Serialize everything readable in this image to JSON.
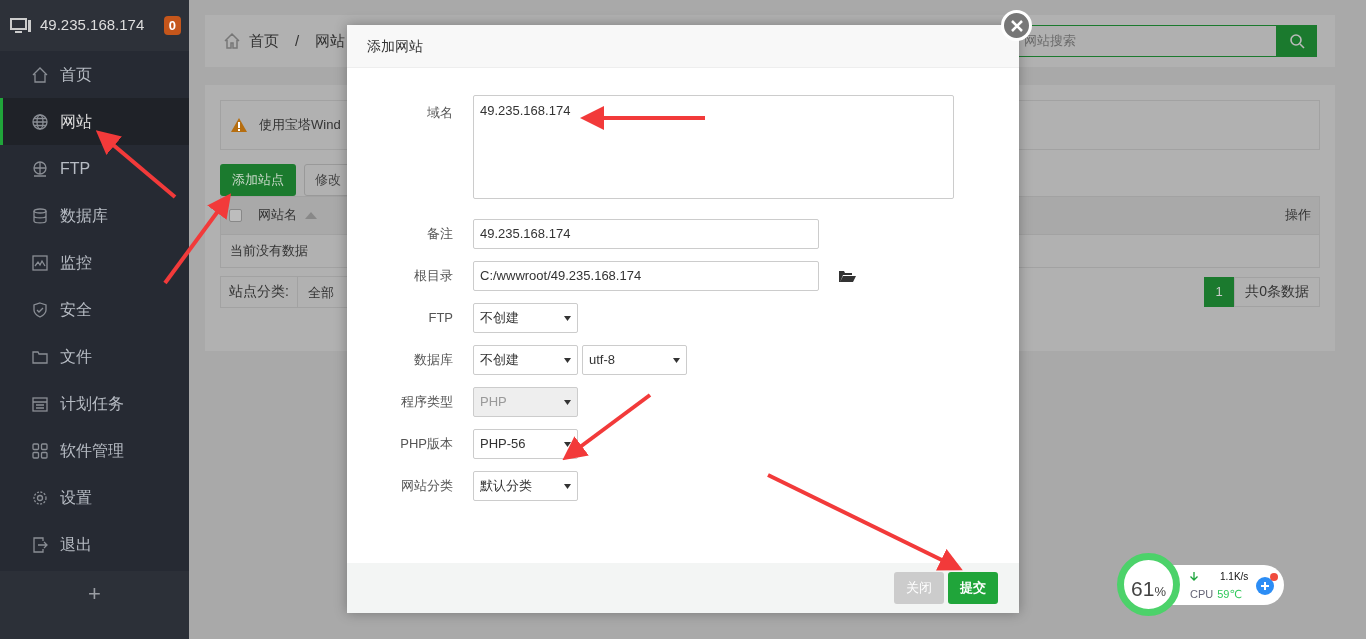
{
  "sidebar": {
    "host": "49.235.168.174",
    "badge": "0",
    "items": [
      {
        "label": "首页",
        "selected": false
      },
      {
        "label": "网站",
        "selected": true
      },
      {
        "label": "FTP",
        "selected": false
      },
      {
        "label": "数据库",
        "selected": false
      },
      {
        "label": "监控",
        "selected": false
      },
      {
        "label": "安全",
        "selected": false
      },
      {
        "label": "文件",
        "selected": false
      },
      {
        "label": "计划任务",
        "selected": false
      },
      {
        "label": "软件管理",
        "selected": false
      },
      {
        "label": "设置",
        "selected": false
      },
      {
        "label": "退出",
        "selected": false
      }
    ],
    "add": "+"
  },
  "breadcrumb": [
    "首页",
    "/",
    "网站"
  ],
  "search": {
    "placeholder": "网站搜索"
  },
  "notice": "使用宝塔Wind",
  "buttons": [
    "添加站点",
    "修改"
  ],
  "table": {
    "checked": false,
    "columns": [
      "网站名",
      "操作"
    ],
    "empty": "当前没有数据"
  },
  "filter": {
    "label": "站点分类:",
    "value": "全部"
  },
  "pager": {
    "page": "1",
    "total": "共0条数据"
  },
  "dialog": {
    "title": "添加网站",
    "rows": [
      {
        "kind": "textarea",
        "label": "域名",
        "value": "49.235.168.174"
      },
      {
        "kind": "input",
        "label": "备注",
        "value": "49.235.168.174"
      },
      {
        "kind": "folder",
        "label": "根目录",
        "value": "C:/wwwroot/49.235.168.174"
      },
      {
        "kind": "select",
        "label": "FTP",
        "selects": [
          {
            "value": "不创建",
            "disabled": false
          }
        ]
      },
      {
        "kind": "select",
        "label": "数据库",
        "selects": [
          {
            "value": "不创建",
            "disabled": false
          },
          {
            "value": "utf-8",
            "disabled": false
          }
        ]
      },
      {
        "kind": "select",
        "label": "程序类型",
        "selects": [
          {
            "value": "PHP",
            "disabled": true
          }
        ]
      },
      {
        "kind": "select",
        "label": "PHP版本",
        "selects": [
          {
            "value": "PHP-56",
            "disabled": false
          }
        ]
      },
      {
        "kind": "select",
        "label": "网站分类",
        "selects": [
          {
            "value": "默认分类",
            "disabled": false
          }
        ]
      }
    ],
    "buttons": [
      {
        "label": "关闭",
        "kind": "close"
      },
      {
        "label": "提交",
        "kind": "submit"
      }
    ]
  },
  "monitor": {
    "percent": "61",
    "unit": "%",
    "speed": "1.1K/s",
    "cpu_label": "CPU",
    "temp": "59℃"
  }
}
